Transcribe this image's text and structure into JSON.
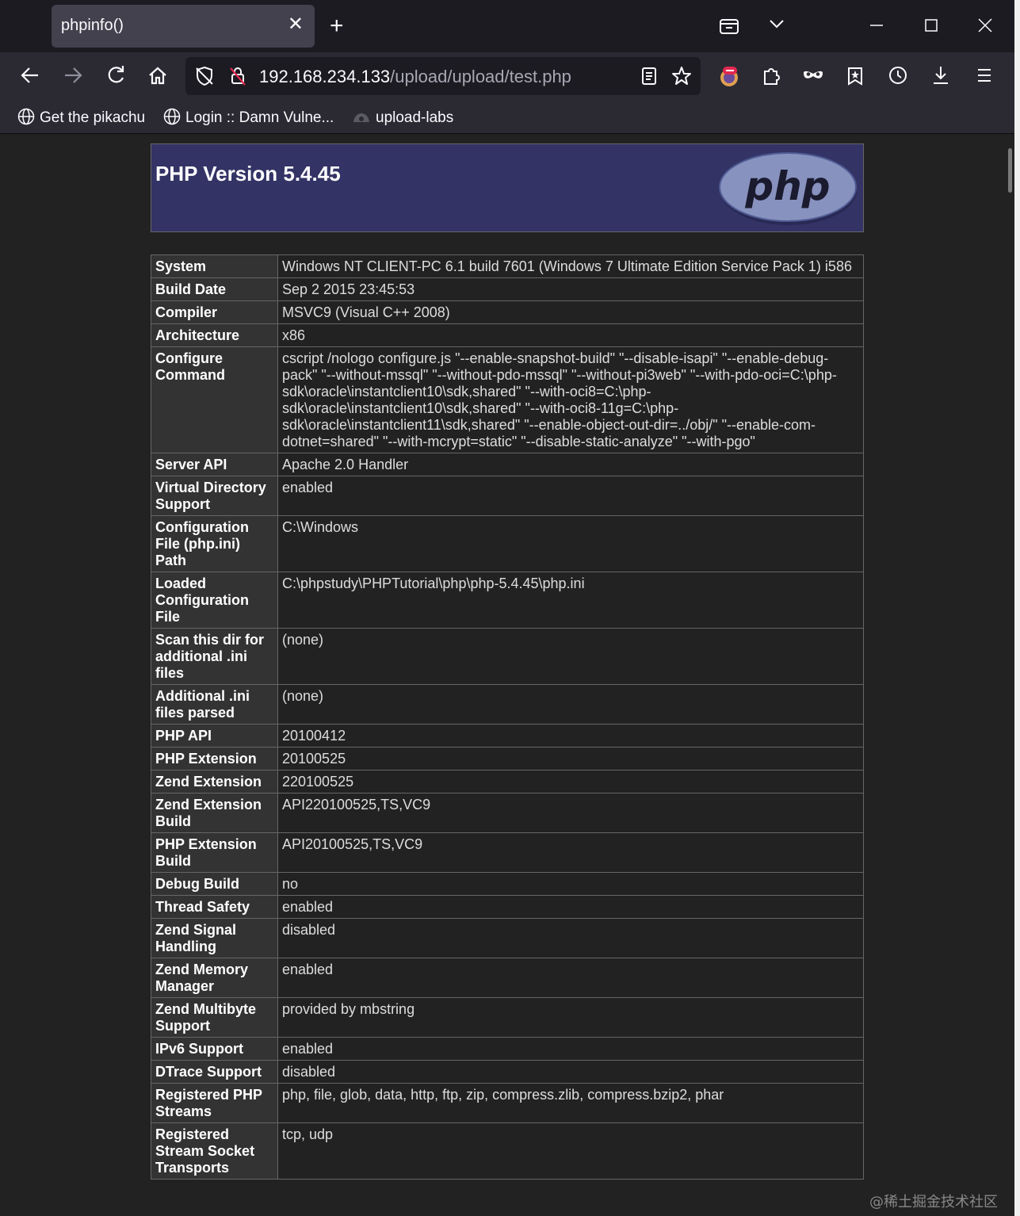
{
  "tab": {
    "title": "phpinfo()"
  },
  "url": {
    "host": "192.168.234.133",
    "path": "/upload/upload/test.php"
  },
  "bookmarks": [
    {
      "label": "Get the pikachu"
    },
    {
      "label": "Login :: Damn Vulne..."
    },
    {
      "label": "upload-labs"
    }
  ],
  "php": {
    "version_heading": "PHP Version 5.4.45",
    "logo_text": "php"
  },
  "rows": [
    {
      "key": "System",
      "value": "Windows NT CLIENT-PC 6.1 build 7601 (Windows 7 Ultimate Edition Service Pack 1) i586"
    },
    {
      "key": "Build Date",
      "value": "Sep 2 2015 23:45:53"
    },
    {
      "key": "Compiler",
      "value": "MSVC9 (Visual C++ 2008)"
    },
    {
      "key": "Architecture",
      "value": "x86"
    },
    {
      "key": "Configure Command",
      "value": "cscript /nologo configure.js \"--enable-snapshot-build\" \"--disable-isapi\" \"--enable-debug-pack\" \"--without-mssql\" \"--without-pdo-mssql\" \"--without-pi3web\" \"--with-pdo-oci=C:\\php-sdk\\oracle\\instantclient10\\sdk,shared\" \"--with-oci8=C:\\php-sdk\\oracle\\instantclient10\\sdk,shared\" \"--with-oci8-11g=C:\\php-sdk\\oracle\\instantclient11\\sdk,shared\" \"--enable-object-out-dir=../obj/\" \"--enable-com-dotnet=shared\" \"--with-mcrypt=static\" \"--disable-static-analyze\" \"--with-pgo\""
    },
    {
      "key": "Server API",
      "value": "Apache 2.0 Handler"
    },
    {
      "key": "Virtual Directory Support",
      "value": "enabled"
    },
    {
      "key": "Configuration File (php.ini) Path",
      "value": "C:\\Windows"
    },
    {
      "key": "Loaded Configuration File",
      "value": "C:\\phpstudy\\PHPTutorial\\php\\php-5.4.45\\php.ini"
    },
    {
      "key": "Scan this dir for additional .ini files",
      "value": "(none)"
    },
    {
      "key": "Additional .ini files parsed",
      "value": "(none)"
    },
    {
      "key": "PHP API",
      "value": "20100412"
    },
    {
      "key": "PHP Extension",
      "value": "20100525"
    },
    {
      "key": "Zend Extension",
      "value": "220100525"
    },
    {
      "key": "Zend Extension Build",
      "value": "API220100525,TS,VC9"
    },
    {
      "key": "PHP Extension Build",
      "value": "API20100525,TS,VC9"
    },
    {
      "key": "Debug Build",
      "value": "no"
    },
    {
      "key": "Thread Safety",
      "value": "enabled"
    },
    {
      "key": "Zend Signal Handling",
      "value": "disabled"
    },
    {
      "key": "Zend Memory Manager",
      "value": "enabled"
    },
    {
      "key": "Zend Multibyte Support",
      "value": "provided by mbstring"
    },
    {
      "key": "IPv6 Support",
      "value": "enabled"
    },
    {
      "key": "DTrace Support",
      "value": "disabled"
    },
    {
      "key": "Registered PHP Streams",
      "value": "php, file, glob, data, http, ftp, zip, compress.zlib, compress.bzip2, phar"
    },
    {
      "key": "Registered Stream Socket Transports",
      "value": "tcp, udp"
    }
  ],
  "watermark": "@稀土掘金技术社区",
  "colors": {
    "php_header": "#333366",
    "key_cell": "#333333",
    "value_cell": "#222222",
    "tab_active": "#42414d",
    "toolbar": "#2b2a33"
  }
}
